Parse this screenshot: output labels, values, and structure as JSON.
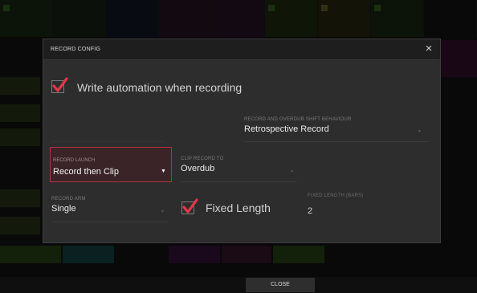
{
  "dialog": {
    "title": "RECORD CONFIG",
    "close_glyph": "×",
    "write_automation": {
      "label": "Write automation when recording",
      "checked": true
    },
    "record_overdub_shift": {
      "label": "RECORD AND OVERDUB SHIFT BEHAVIOUR",
      "value": "Retrospective Record"
    },
    "record_launch": {
      "label": "RECORD LAUNCH",
      "value": "Record then Clip"
    },
    "clip_record_to": {
      "label": "CLIP RECORD TO",
      "value": "Overdub"
    },
    "record_arm": {
      "label": "RECORD ARM",
      "value": "Single"
    },
    "fixed_length": {
      "label": "Fixed Length",
      "checked": true
    },
    "fixed_length_bars": {
      "label": "FIXED LENGTH (BARS)",
      "value": "2"
    }
  },
  "footer": {
    "close_label": "CLOSE"
  },
  "colors": {
    "accent_red": "#e0364a",
    "dialog_bg": "#2d2d2d",
    "highlight_border": "#b0343f"
  },
  "icons": {
    "close": "close-icon",
    "check": "check-icon"
  }
}
